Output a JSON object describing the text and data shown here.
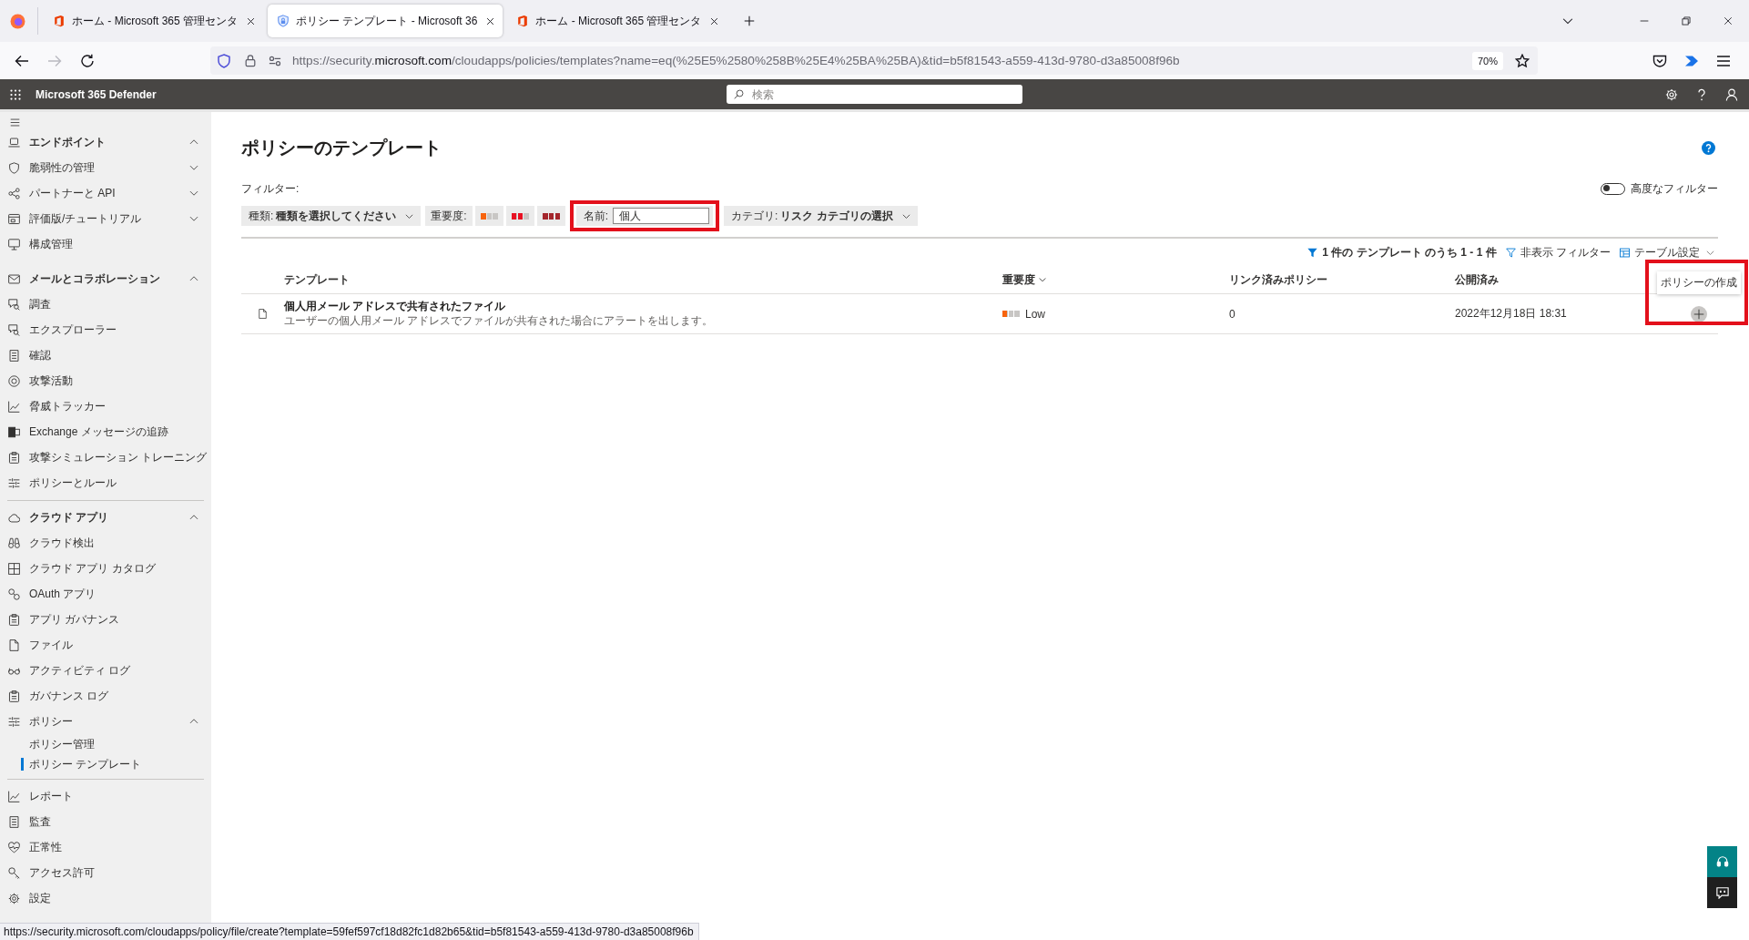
{
  "browser": {
    "tabs": [
      {
        "kind": "office",
        "title": "ホーム - Microsoft 365 管理センタ",
        "selected": false
      },
      {
        "kind": "secure",
        "title": "ポリシー テンプレート - Microsoft 36",
        "selected": true
      },
      {
        "kind": "office",
        "title": "ホーム - Microsoft 365 管理センタ",
        "selected": false
      }
    ],
    "nav": [
      {
        "kind": "back",
        "disabled": false
      },
      {
        "kind": "forward",
        "disabled": true
      },
      {
        "kind": "reload",
        "disabled": false
      }
    ],
    "address": {
      "prefix": "https://security.",
      "domain": "microsoft.com",
      "path": "/cloudapps/policies/templates?name=eq(%25E5%2580%258B%25E4%25BA%25BA)&tid=b5f81543-a559-413d-9780-d3a85008f96b"
    },
    "zoom": "70%",
    "status_url": "https://security.microsoft.com/cloudapps/policy/file/create?template=59fef597cf18d82fc1d82b65&tid=b5f81543-a559-413d-9780-d3a85008f96b"
  },
  "app_bar": {
    "title": "Microsoft 365 Defender",
    "search": {
      "placeholder": "検索"
    }
  },
  "sidebar": {
    "groups": [
      {
        "label": "エンドポイント",
        "expanded": true,
        "children": [
          {
            "label": "脆弱性の管理",
            "expanded": false
          },
          {
            "label": "パートナーと API",
            "expanded": false
          },
          {
            "label": "評価版/チュートリアル",
            "expanded": false
          },
          {
            "label": "構成管理",
            "selected": false
          }
        ]
      },
      {
        "label": "メールとコラボレーション",
        "expanded": true,
        "children": [
          {
            "label": "調査",
            "selected": false
          },
          {
            "label": "エクスプローラー",
            "selected": false
          },
          {
            "label": "確認",
            "selected": false
          },
          {
            "label": "攻撃活動",
            "selected": false
          },
          {
            "label": "脅威トラッカー",
            "selected": false
          },
          {
            "label": "Exchange メッセージの追跡",
            "selected": false
          },
          {
            "label": "攻撃シミュレーション トレーニング",
            "selected": false
          },
          {
            "label": "ポリシーとルール",
            "selected": false
          }
        ]
      },
      {
        "label": "クラウド アプリ",
        "expanded": true,
        "children": [
          {
            "label": "クラウド検出",
            "selected": false
          },
          {
            "label": "クラウド アプリ カタログ",
            "selected": false
          },
          {
            "label": "OAuth アプリ",
            "selected": false
          },
          {
            "label": "アプリ ガバナンス",
            "selected": false
          },
          {
            "label": "ファイル",
            "selected": false
          },
          {
            "label": "アクティビティ ログ",
            "selected": false
          },
          {
            "label": "ガバナンス ログ",
            "selected": false
          },
          {
            "label": "ポリシー",
            "expanded": true,
            "children": [
              {
                "label": "ポリシー管理",
                "selected": false
              },
              {
                "label": "ポリシー テンプレート",
                "selected": true
              }
            ]
          }
        ]
      }
    ],
    "footer": [
      {
        "label": "レポート",
        "selected": false
      },
      {
        "label": "監査",
        "selected": false
      },
      {
        "label": "正常性",
        "selected": false
      },
      {
        "label": "アクセス許可",
        "selected": false
      },
      {
        "label": "設定",
        "selected": false
      }
    ]
  },
  "page": {
    "title": "ポリシーのテンプレート",
    "filters": {
      "label": "フィルター:",
      "advanced": {
        "label": "高度なフィルター",
        "on": false
      },
      "items": [
        {
          "kind": "dropdown",
          "label": "種類:",
          "value": "種類を選択してください",
          "highlighted": false
        },
        {
          "kind": "severity",
          "label": "重要度:",
          "highlighted": false,
          "options": [
            {
              "level": 0.33,
              "selected": false
            },
            {
              "level": 0.67,
              "selected": false
            },
            {
              "level": 1,
              "selected": false
            }
          ]
        },
        {
          "kind": "text",
          "label": "名前:",
          "value": "個人",
          "highlighted": true
        },
        {
          "kind": "dropdown",
          "label": "カテゴリ:",
          "value": "リスク カテゴリの選択",
          "highlighted": false
        }
      ]
    },
    "toolbar": {
      "count": "1 件の テンプレート のうち 1 - 1 件",
      "hide_filters": "非表示 フィルター",
      "table_settings": "テーブル設定"
    },
    "table": {
      "columns": [
        {
          "label": "テンプレート",
          "sorted": false
        },
        {
          "label": "重要度",
          "sorted": true
        },
        {
          "label": "リンク済みポリシー",
          "sorted": false
        },
        {
          "label": "公開済み",
          "sorted": false
        }
      ],
      "rows": [
        {
          "title": "個人用メール アドレスで共有されたファイル",
          "description": "ユーザーの個人用メール アドレスでファイルが共有された場合にアラートを出します。",
          "severity": {
            "label": "Low",
            "level": 0.33
          },
          "linked_policies": "0",
          "published": "2022年12月18日 18:31",
          "action": {
            "tooltip": "ポリシーの作成",
            "highlighted": true
          }
        }
      ]
    }
  }
}
